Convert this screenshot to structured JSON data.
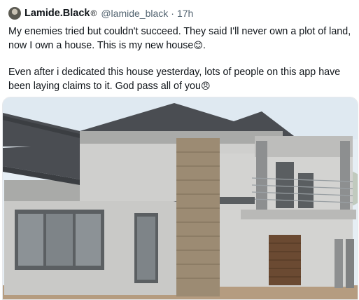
{
  "tweet": {
    "author_name": "Lamide.Black",
    "verified_mark": "®",
    "handle": "@lamide_black",
    "separator": "·",
    "time": "17h",
    "paragraph1": "My enemies tried but couldn't succeed. They said I'll never own a plot of land, now I own a house. This is my new house",
    "paragraph1_emoji": "😊",
    "paragraph1_end": ".",
    "paragraph2": "Even after i dedicated this house yesterday, lots of people on this app have been laying claims to it. God pass all of you",
    "paragraph2_emoji": "😠"
  },
  "media": {
    "icon": "photo-of-house",
    "colors": {
      "sky": "#e6eef4",
      "wall": "#c9c9c7",
      "wall_shadow": "#a9aaa8",
      "roof": "#4a4d52",
      "stone": "#9c8b73",
      "garage_door": "#6b4a32",
      "ground": "#b59c80"
    }
  }
}
